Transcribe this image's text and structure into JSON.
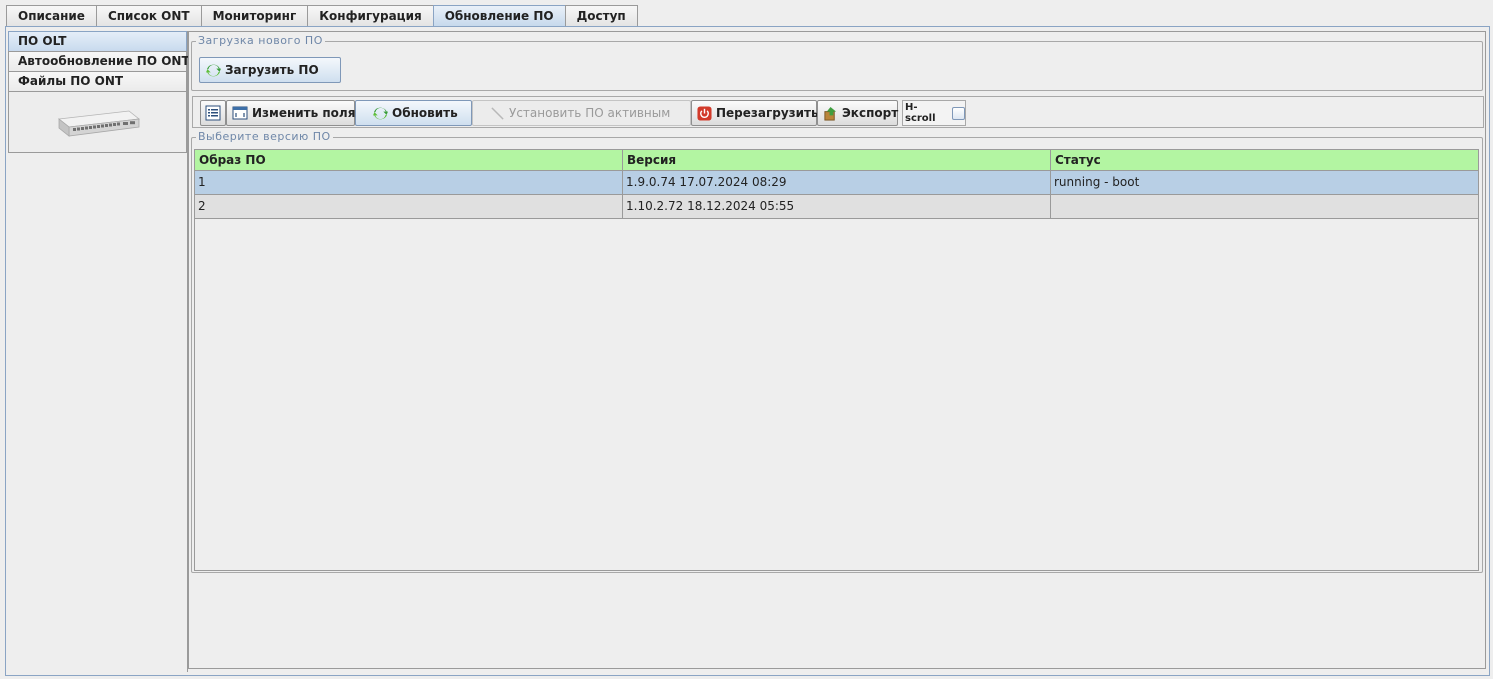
{
  "tabs": [
    "Описание",
    "Список ONT",
    "Мониторинг",
    "Конфигурация",
    "Обновление ПО",
    "Доступ"
  ],
  "active_tab": "Обновление ПО",
  "side_tabs": [
    "ПО OLT",
    "Автообновление ПО ONT",
    "Файлы ПО ONT"
  ],
  "active_side_tab": "ПО OLT",
  "upload_group": {
    "legend": "Загрузка нового ПО",
    "upload_button": "Загрузить ПО"
  },
  "toolbar": {
    "edit_fields": "Изменить поля",
    "refresh": "Обновить",
    "set_active": "Установить ПО активным",
    "reboot": "Перезагрузить",
    "export": "Экспорт",
    "hscroll": "H-scroll"
  },
  "version_group": {
    "legend": "Выберите версию ПО",
    "columns": [
      "Образ ПО",
      "Версия",
      "Статус"
    ],
    "rows": [
      {
        "image": "1",
        "version": "1.9.0.74 17.07.2024 08:29",
        "status": "running - boot"
      },
      {
        "image": "2",
        "version": "1.10.2.72 18.12.2024 05:55",
        "status": ""
      }
    ]
  },
  "colors": {
    "header_bg": "#b3f5a2",
    "selected_row": "#b8cfe5",
    "legend_text": "#6f87a8",
    "active_tab": "#c7d9ec"
  }
}
